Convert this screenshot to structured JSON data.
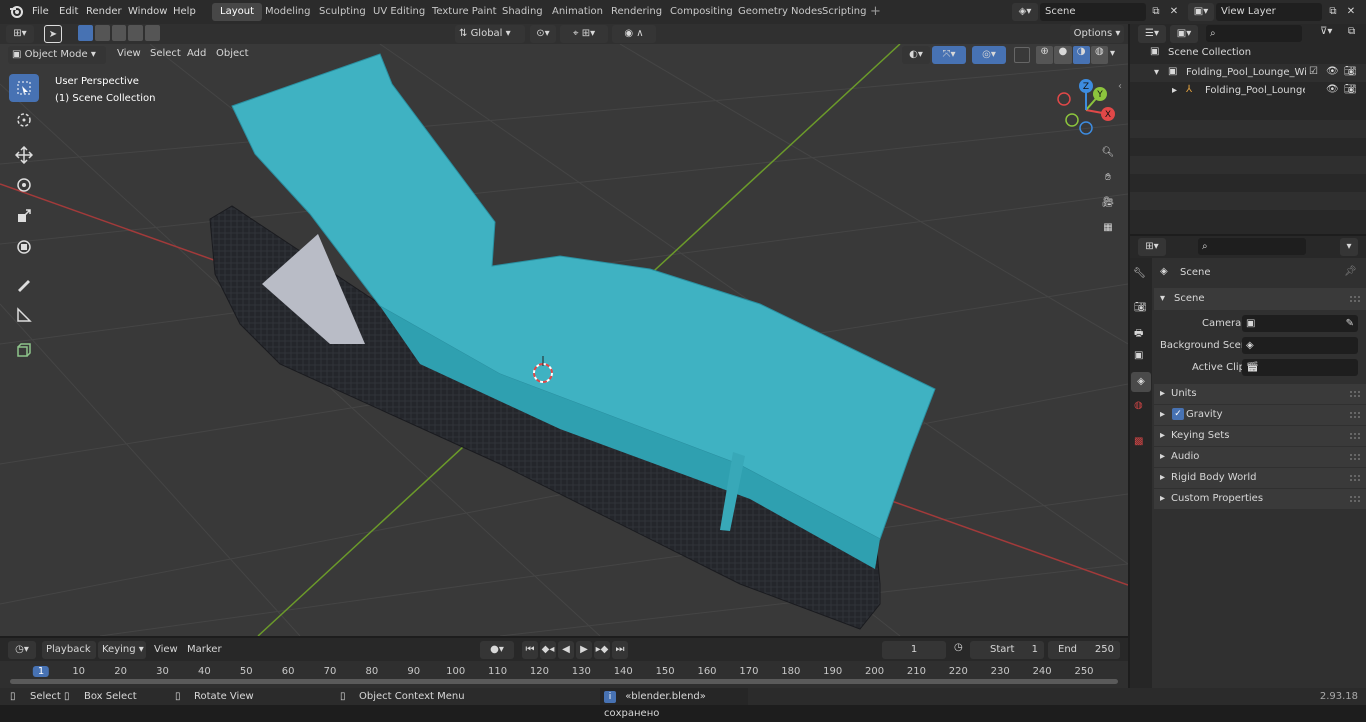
{
  "topbar": {
    "menus": [
      "File",
      "Edit",
      "Render",
      "Window",
      "Help"
    ],
    "workspaces": [
      "Layout",
      "Modeling",
      "Sculpting",
      "UV Editing",
      "Texture Paint",
      "Shading",
      "Animation",
      "Rendering",
      "Compositing",
      "Geometry Nodes",
      "Scripting"
    ],
    "active_workspace": "Layout",
    "scene_name": "Scene",
    "view_layer": "View Layer"
  },
  "viewport_header": {
    "mode": "Object Mode",
    "menus": [
      "View",
      "Select",
      "Add",
      "Object"
    ],
    "orientation": "Global",
    "options_label": "Options"
  },
  "viewport": {
    "perspective_label": "User Perspective",
    "collection_label": "(1) Scene Collection"
  },
  "gizmo": {
    "x": "X",
    "y": "Y",
    "z": "Z"
  },
  "outliner": {
    "scene_collection": "Scene Collection",
    "items": [
      {
        "name": "Folding_Pool_Lounge_Wicker_"
      },
      {
        "name": "Folding_Pool_Lounge_Wi"
      }
    ]
  },
  "properties": {
    "context_title": "Scene",
    "section_title": "Scene",
    "camera_label": "Camera",
    "background_label": "Background Scene",
    "clip_label": "Active Clip",
    "panels": [
      "Units",
      "Gravity",
      "Keying Sets",
      "Audio",
      "Rigid Body World",
      "Custom Properties"
    ]
  },
  "timeline": {
    "menus": [
      "Playback",
      "Keying",
      "View",
      "Marker"
    ],
    "current_frame": "1",
    "start_label": "Start",
    "start_value": "1",
    "end_label": "End",
    "end_value": "250",
    "ruler_ticks": [
      "1",
      "10",
      "20",
      "30",
      "40",
      "50",
      "60",
      "70",
      "80",
      "90",
      "100",
      "110",
      "120",
      "130",
      "140",
      "150",
      "160",
      "170",
      "180",
      "190",
      "200",
      "210",
      "220",
      "230",
      "240",
      "250"
    ]
  },
  "statusbar": {
    "select": "Select",
    "box_select": "Box Select",
    "rotate_view": "Rotate View",
    "context_menu": "Object Context Menu",
    "message": "«blender.blend» сохранено",
    "version": "2.93.18"
  },
  "colors": {
    "accent": "#4772b3",
    "towel": "#3db3c4",
    "wicker": "#26282d",
    "x_axis": "#e04848",
    "y_axis": "#8cc43d",
    "z_axis": "#3d8ce0"
  }
}
